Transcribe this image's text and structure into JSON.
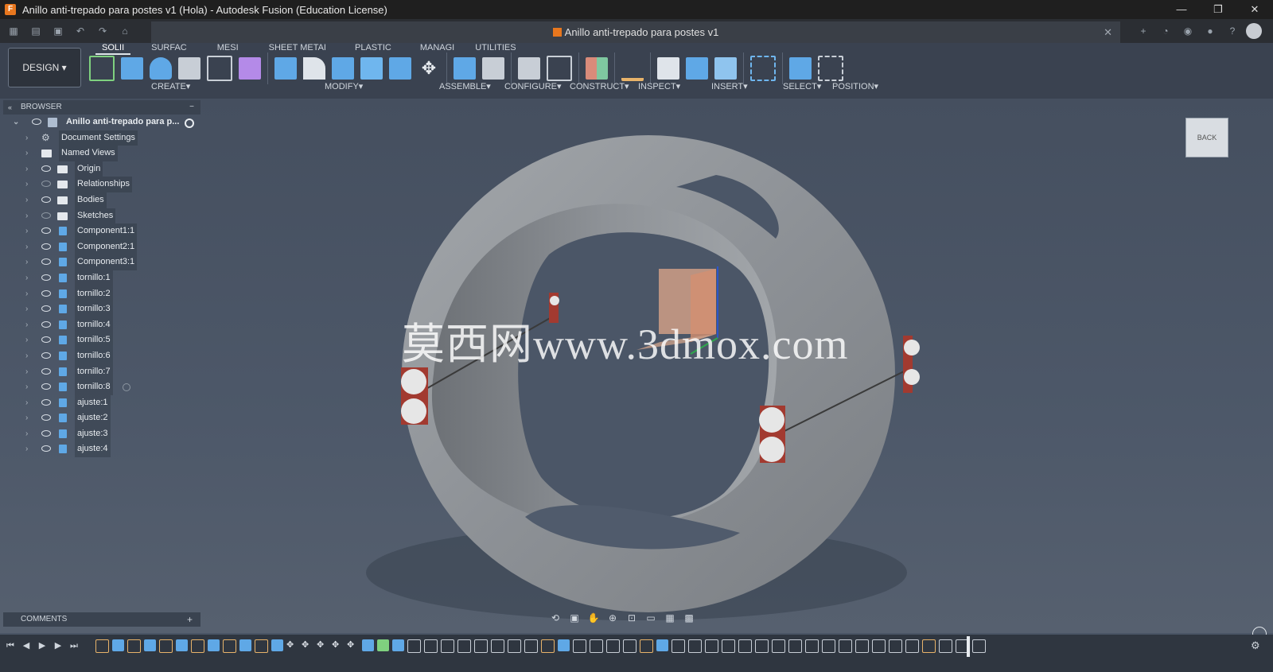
{
  "window": {
    "title": "Anillo anti-trepado para postes v1 (Hola) - Autodesk Fusion (Education License)",
    "controls": [
      "—",
      "❐",
      "✕"
    ]
  },
  "doc_tab": {
    "title": "Anillo anti-trepado para postes v1",
    "close": "✕"
  },
  "workspace": {
    "label": "DESIGN ▾"
  },
  "ribbon": {
    "tabs": [
      "SOLII",
      "SURFAC",
      "MESI",
      "SHEET METAI",
      "PLASTIC",
      "MANAGI",
      "UTILITIES"
    ],
    "groups": [
      "CREATE▾",
      "MODIFY▾",
      "ASSEMBLE▾",
      "CONFIGURE▾",
      "CONSTRUCT▾",
      "INSPECT▾",
      "INSERT▾",
      "SELECT▾",
      "POSITION▾"
    ]
  },
  "browser": {
    "title": "BROWSER",
    "root": "Anillo anti-trepado para p...",
    "items": [
      {
        "label": "Document Settings",
        "icon": "gear-icon"
      },
      {
        "label": "Named Views",
        "icon": "folder-icon"
      },
      {
        "label": "Origin",
        "icon": "folder-icon"
      },
      {
        "label": "Relationships",
        "icon": "folder-icon"
      },
      {
        "label": "Bodies",
        "icon": "folder-icon"
      },
      {
        "label": "Sketches",
        "icon": "folder-icon"
      },
      {
        "label": "Component1:1",
        "icon": "component-icon"
      },
      {
        "label": "Component2:1",
        "icon": "component-icon"
      },
      {
        "label": "Component3:1",
        "icon": "component-icon"
      },
      {
        "label": "tornillo:1",
        "icon": "component-icon"
      },
      {
        "label": "tornillo:2",
        "icon": "component-icon"
      },
      {
        "label": "tornillo:3",
        "icon": "component-icon"
      },
      {
        "label": "tornillo:4",
        "icon": "component-icon"
      },
      {
        "label": "tornillo:5",
        "icon": "component-icon"
      },
      {
        "label": "tornillo:6",
        "icon": "component-icon"
      },
      {
        "label": "tornillo:7",
        "icon": "component-icon"
      },
      {
        "label": "tornillo:8",
        "icon": "component-icon"
      },
      {
        "label": "ajuste:1",
        "icon": "component-icon"
      },
      {
        "label": "ajuste:2",
        "icon": "component-icon"
      },
      {
        "label": "ajuste:3",
        "icon": "component-icon"
      },
      {
        "label": "ajuste:4",
        "icon": "component-icon"
      }
    ]
  },
  "comments": {
    "title": "COMMENTS",
    "add": "+"
  },
  "viewcube": {
    "face": "BACK"
  },
  "watermark": "莫西网www.3dmox.com",
  "colors": {
    "accent": "#e8771e",
    "viewport": "#4a5566",
    "ring": "#8f9499",
    "component": "#5fa8e6"
  }
}
